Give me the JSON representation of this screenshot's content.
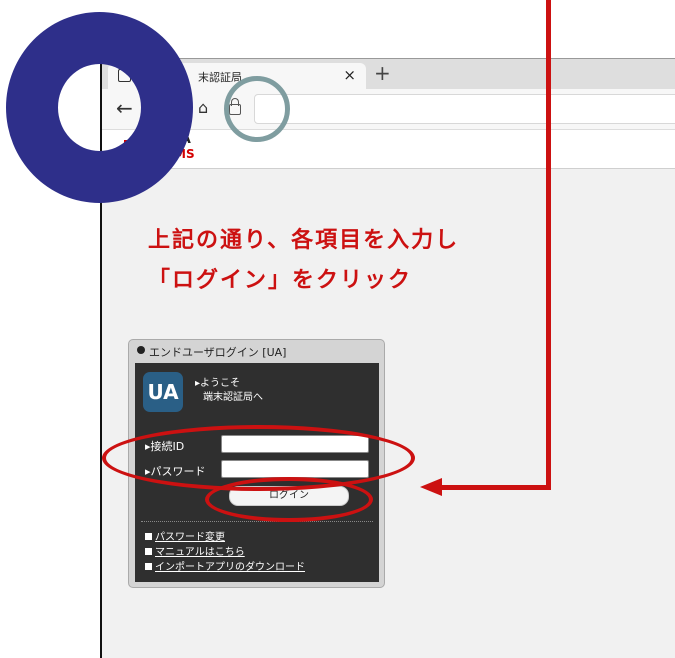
{
  "browser": {
    "tab_title": "末認証局",
    "tab_close": "×",
    "tab_new": "+",
    "back_icon": "←",
    "home_icon": "⌂"
  },
  "site": {
    "logo_a": "A",
    "logo_ms": "MS"
  },
  "annotation": {
    "line1": "上記の通り、各項目を入力し",
    "line2": "「ログイン」をクリック",
    "color": "#cc1111",
    "ring_color": "#2e2f8a",
    "lock_circle_color": "#7f9da0"
  },
  "login_panel": {
    "title": "エンドユーザログイン [UA]",
    "logo": "UA",
    "welcome_line1": "▸ようこそ",
    "welcome_line2": "端末認証局へ",
    "id_label": "▸接続ID",
    "password_label": "▸パスワード",
    "id_value": "",
    "password_value": "",
    "login_button": "ログイン",
    "links": [
      "パスワード変更",
      "マニュアルはこちら",
      "インポートアプリのダウンロード"
    ]
  }
}
